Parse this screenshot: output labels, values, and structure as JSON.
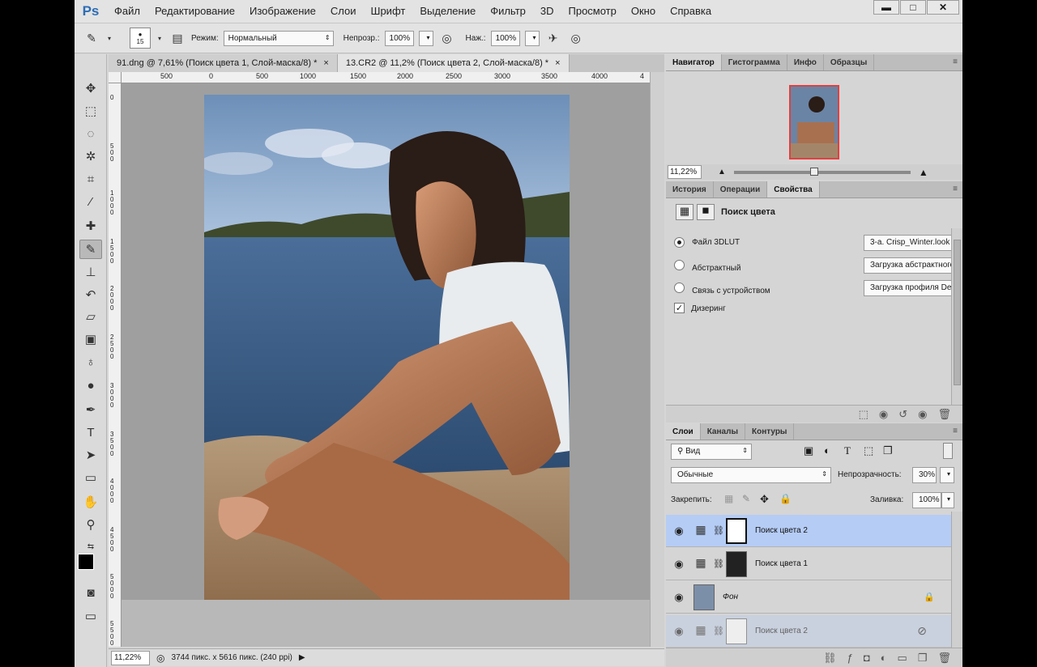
{
  "app": {
    "logo": "Ps",
    "menu": [
      "Файл",
      "Редактирование",
      "Изображение",
      "Слои",
      "Шрифт",
      "Выделение",
      "Фильтр",
      "3D",
      "Просмотр",
      "Окно",
      "Справка"
    ]
  },
  "options": {
    "brush_size": "15",
    "mode_label": "Режим:",
    "mode_value": "Нормальный",
    "opacity_label": "Непрозр.:",
    "opacity_value": "100%",
    "pressure_label": "Наж.:",
    "pressure_value": "100%"
  },
  "tabs": [
    {
      "label": "91.dng @ 7,61% (Поиск цвета 1, Слой-маска/8) *",
      "close": "×"
    },
    {
      "label": "13.CR2 @ 11,2% (Поиск цвета 2, Слой-маска/8) *",
      "close": "×"
    }
  ],
  "rulers": {
    "top": [
      "500",
      "0",
      "500",
      "1000",
      "1500",
      "2000",
      "2500",
      "3000",
      "3500",
      "4000",
      "4"
    ],
    "left": [
      "0",
      "5 0 0",
      "1 0 0 0",
      "1 5 0 0",
      "2 0 0 0",
      "2 5 0 0",
      "3 0 0 0",
      "3 5 0 0",
      "4 0 0 0",
      "4 5 0 0",
      "5 0 0 0",
      "5 5 0 0"
    ]
  },
  "status": {
    "zoom": "11,22%",
    "info": "3744 пикс. x 5616 пикс. (240 ppi)"
  },
  "navigator": {
    "tabs": [
      "Навигатор",
      "Гистограмма",
      "Инфо",
      "Образцы"
    ],
    "zoom": "11,22%",
    "zoom_slider": 0.45
  },
  "properties": {
    "tabs": [
      "История",
      "Операции",
      "Свойства"
    ],
    "title": "Поиск цвета",
    "options": [
      {
        "label": "Файл 3DLUT",
        "value": "3-а. Crisp_Winter.look",
        "selected": true
      },
      {
        "label": "Абстрактный",
        "value": "Загрузка абстрактного профи...",
        "selected": false
      },
      {
        "label": "Связь с устройством",
        "value": "Загрузка профиля DeviceLink...",
        "selected": false
      }
    ],
    "dither_label": "Дизеринг",
    "dither_checked": true
  },
  "layers": {
    "tabs": [
      "Слои",
      "Каналы",
      "Контуры"
    ],
    "filter_label": "Вид",
    "blend_mode": "Обычные",
    "opacity_label": "Непрозрачность:",
    "opacity_value": "30%",
    "lock_label": "Закрепить:",
    "fill_label": "Заливка:",
    "fill_value": "100%",
    "items": [
      {
        "name": "Поиск цвета 2",
        "selected": true
      },
      {
        "name": "Поиск цвета 1",
        "selected": false
      },
      {
        "name": "Фон",
        "selected": false
      },
      {
        "name": "Поиск цвета 2",
        "selected": false
      }
    ]
  },
  "colors": {
    "accent_selected": "#b5ccf5",
    "ps_blue": "#2d6db5"
  }
}
